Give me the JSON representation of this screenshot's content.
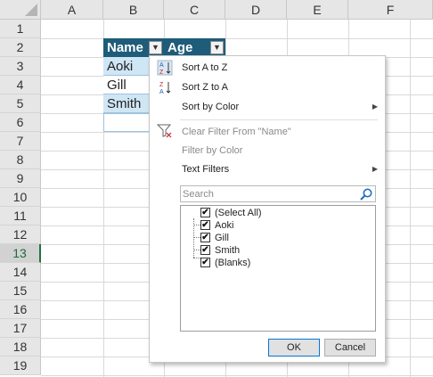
{
  "columns": [
    "A",
    "B",
    "C",
    "D",
    "E",
    "F"
  ],
  "rows": [
    "1",
    "2",
    "3",
    "4",
    "5",
    "6",
    "7",
    "8",
    "9",
    "10",
    "11",
    "12",
    "13",
    "14",
    "15",
    "16",
    "17",
    "18",
    "19"
  ],
  "selected_row": "13",
  "table": {
    "headers": [
      "Name",
      "Age"
    ],
    "rows": [
      "Aoki",
      "Gill",
      "Smith"
    ]
  },
  "menu": {
    "sort_az": "Sort A to Z",
    "sort_za": "Sort Z to A",
    "sort_color": "Sort by Color",
    "clear_filter": "Clear Filter From \"Name\"",
    "filter_color": "Filter by Color",
    "text_filters": "Text Filters",
    "search_placeholder": "Search",
    "items": [
      "(Select All)",
      "Aoki",
      "Gill",
      "Smith",
      "(Blanks)"
    ],
    "ok": "OK",
    "cancel": "Cancel"
  },
  "colors": {
    "header_fill": "#1f5c7a",
    "data_fill": "#cfe6f5",
    "accent": "#217346"
  }
}
